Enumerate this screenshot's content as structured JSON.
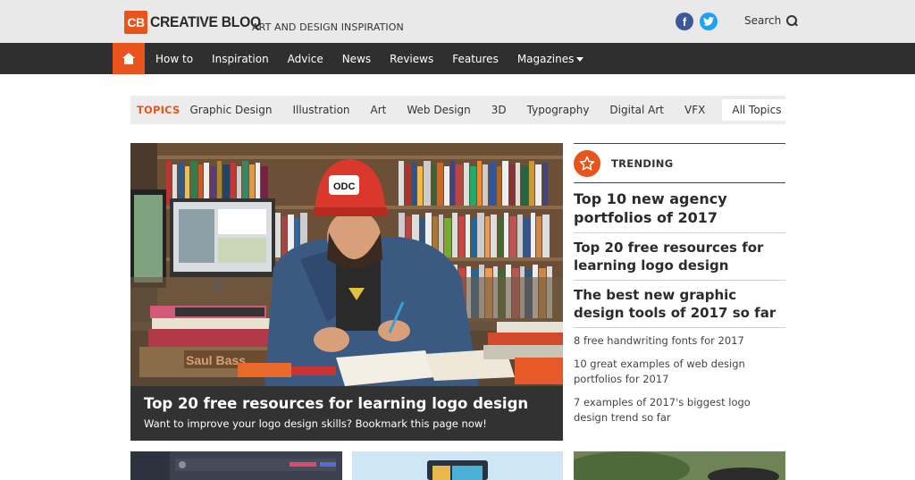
{
  "header": {
    "logo_mark": "CB",
    "logo_text": "CREATIVE BLOQ",
    "tagline": "ART AND DESIGN INSPIRATION",
    "facebook_icon": "facebook-icon",
    "twitter_icon": "twitter-icon",
    "search_label": "Search"
  },
  "nav": {
    "items": [
      "How to",
      "Inspiration",
      "Advice",
      "News",
      "Reviews",
      "Features",
      "Magazines"
    ]
  },
  "topics": {
    "label": "TOPICS",
    "items": [
      "Graphic Design",
      "Illustration",
      "Art",
      "Web Design",
      "3D",
      "Typography",
      "Digital Art",
      "VFX"
    ],
    "all_label": "All Topics"
  },
  "hero": {
    "title": "Top 20 free resources for learning logo design",
    "subtitle": "Want to improve your logo design skills? Bookmark this page now!",
    "cap_text": "ODC",
    "book_text": "Saul Bass"
  },
  "trending": {
    "label": "TRENDING",
    "big": [
      "Top 10 new agency portfolios of 2017",
      "Top 20 free resources for learning logo design",
      "The best new graphic design tools of 2017 so far"
    ],
    "small": [
      "8 free handwriting fonts for 2017",
      "10 great examples of web design portfolios for 2017",
      "7 examples of 2017's biggest logo design trend so far"
    ]
  },
  "colors": {
    "accent": "#e8541c",
    "nav_bg": "#2f2f2f",
    "header_bg": "#e9e9e9"
  }
}
